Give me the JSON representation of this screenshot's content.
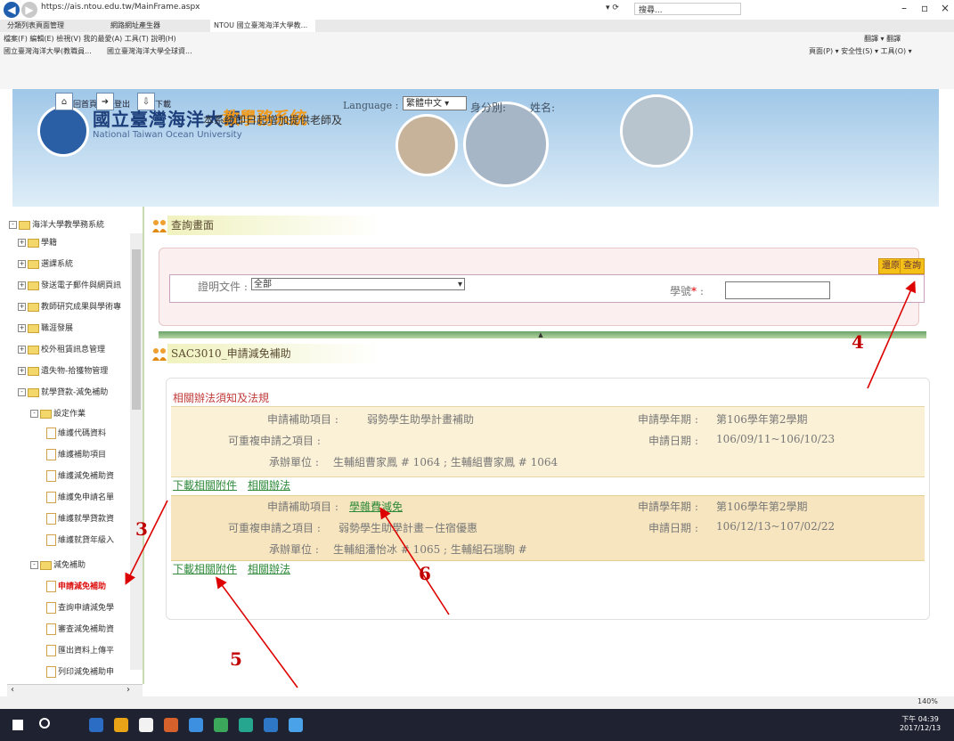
{
  "browser": {
    "url": "https://ais.ntou.edu.tw/MainFrame.aspx",
    "search_placeholder": "搜尋...",
    "tabs": [
      "分類列表頁面管理",
      "網路網址產生器",
      "NTOU 國立臺灣海洋大學教..."
    ],
    "menu": "檔案(F)  編輯(E)  檢視(V)  我的最愛(A)  工具(T)  說明(H)",
    "favorites": [
      "國立臺灣海洋大學(教職員...",
      "國立臺灣海洋大學全球資..."
    ],
    "right_tools": "頁面(P) ▾  安全性(S) ▾  工具(O) ▾",
    "top_right": "翻譯 ▾  翻譯",
    "zoom": "140%",
    "clock_time": "下午 04:39",
    "clock_date": "2017/12/13"
  },
  "header": {
    "univ_cn": "國立臺灣海洋大學",
    "univ_en": "National Taiwan Ocean University",
    "system_name": "教學務系統",
    "home_label": "回首頁",
    "logout_label": "登出",
    "download_label": "下載",
    "language_label": "Language :",
    "language_value": "繁體中文",
    "id_label": "身分別:",
    "name_label": "姓名:",
    "marquee": "本系統即日起增加提供老師及"
  },
  "sidebar": {
    "root": "海洋大學教學務系統",
    "items": [
      "學籍",
      "選課系統",
      "發送電子郵件與網頁訊",
      "教師研究成果與學術專",
      "職涯發展",
      "校外租賃訊息管理",
      "遺失物-拾獲物管理",
      "就學貸款-減免補助"
    ],
    "group_setup": "設定作業",
    "setup_items": [
      "維護代碼資料",
      "維護補助項目",
      "維護減免補助資",
      "維護免申請名單",
      "維護就學貸款資",
      "維護就貸年級入"
    ],
    "group_relief": "減免補助",
    "relief_items": [
      "申請減免補助",
      "查詢申請減免學",
      "審查減免補助資",
      "匯出資料上傳平",
      "列印減免補助申"
    ]
  },
  "query": {
    "title": "查詢畫面",
    "reset_label": "還原",
    "search_label": "查詢",
    "doc_label": "證明文件 :",
    "doc_value": "全部",
    "sid_label": "學號",
    "sid_colon": " :",
    "required_mark": "*"
  },
  "detail": {
    "title": "SAC3010_申請減免補助",
    "notice": "相關辦法須知及法規",
    "block1": {
      "item_label": "申請補助項目 :",
      "item_value": "弱勢學生助學計畫補助",
      "term_label": "申請學年期 :",
      "term_value": "第106學年第2學期",
      "repeat_label": "可重複申請之項目 :",
      "repeat_value": "",
      "date_label": "申請日期 :",
      "date_value": "106/09/11~106/10/23",
      "unit_label": "承辦單位 :",
      "unit_value": "生輔組曹家鳳 # 1064 ; 生輔組曹家鳳 # 1064",
      "dl_link": "下載相關附件",
      "rule_link": "相關辦法"
    },
    "block2": {
      "item_label": "申請補助項目 :",
      "item_value": "學雜費減免",
      "term_label": "申請學年期 :",
      "term_value": "第106學年第2學期",
      "repeat_label": "可重複申請之項目 :",
      "repeat_value": "弱勢學生助學計畫－住宿優惠",
      "date_label": "申請日期 :",
      "date_value": "106/12/13~107/02/22",
      "unit_label": "承辦單位 :",
      "unit_value": "生輔組潘怡冰 # 1065 ; 生輔組石瑞駒 #",
      "dl_link": "下載相關附件",
      "rule_link": "相關辦法"
    }
  },
  "annotations": [
    "3",
    "4",
    "5",
    "6"
  ]
}
